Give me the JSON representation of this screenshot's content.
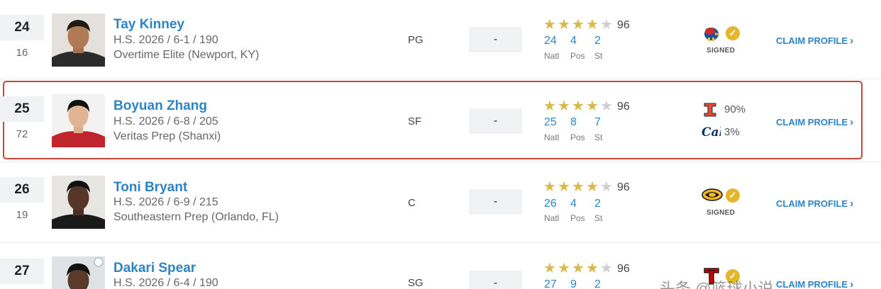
{
  "colors": {
    "link_blue": "#2e83c3",
    "star_gold": "#d8b94a",
    "highlight_red": "#c9453a",
    "check_gold": "#e2b72b"
  },
  "labels": {
    "natl": "Natl",
    "pos": "Pos",
    "st": "St",
    "claim": "CLAIM PROFILE",
    "signed": "SIGNED",
    "dash": "-"
  },
  "players": [
    {
      "rank": "24",
      "prev_rank": "16",
      "name": "Tay Kinney",
      "details": "H.S. 2026 / 6-1 / 190",
      "school": "Overtime Elite (Newport, KY)",
      "position": "PG",
      "stars": 4,
      "rating": "96",
      "natl": "24",
      "pos_rank": "4",
      "st_rank": "2",
      "commit_logo": "kansas-jayhawk-logo",
      "status": "signed"
    },
    {
      "rank": "25",
      "prev_rank": "72",
      "name": "Boyuan Zhang",
      "details": "H.S. 2026 / 6-8 / 205",
      "school": "Veritas Prep (Shanxi)",
      "position": "SF",
      "stars": 4,
      "rating": "96",
      "natl": "25",
      "pos_rank": "8",
      "st_rank": "7",
      "predictions": [
        {
          "logo": "illinois-logo",
          "pct": "90%"
        },
        {
          "logo": "cal-logo",
          "pct": "3%"
        }
      ]
    },
    {
      "rank": "26",
      "prev_rank": "19",
      "name": "Toni Bryant",
      "details": "H.S. 2026 / 6-9 / 215",
      "school": "Southeastern Prep (Orlando, FL)",
      "position": "C",
      "stars": 4,
      "rating": "96",
      "natl": "26",
      "pos_rank": "4",
      "st_rank": "2",
      "commit_logo": "missouri-tiger-logo",
      "status": "signed"
    },
    {
      "rank": "27",
      "name": "Dakari Spear",
      "details": "H.S. 2026 / 6-4 / 190",
      "position": "SG",
      "stars": 4,
      "rating": "96",
      "natl": "27",
      "pos_rank": "9",
      "st_rank": "2",
      "commit_logo": "texas-tech-logo"
    }
  ],
  "watermark": "头条 @篮球小说"
}
